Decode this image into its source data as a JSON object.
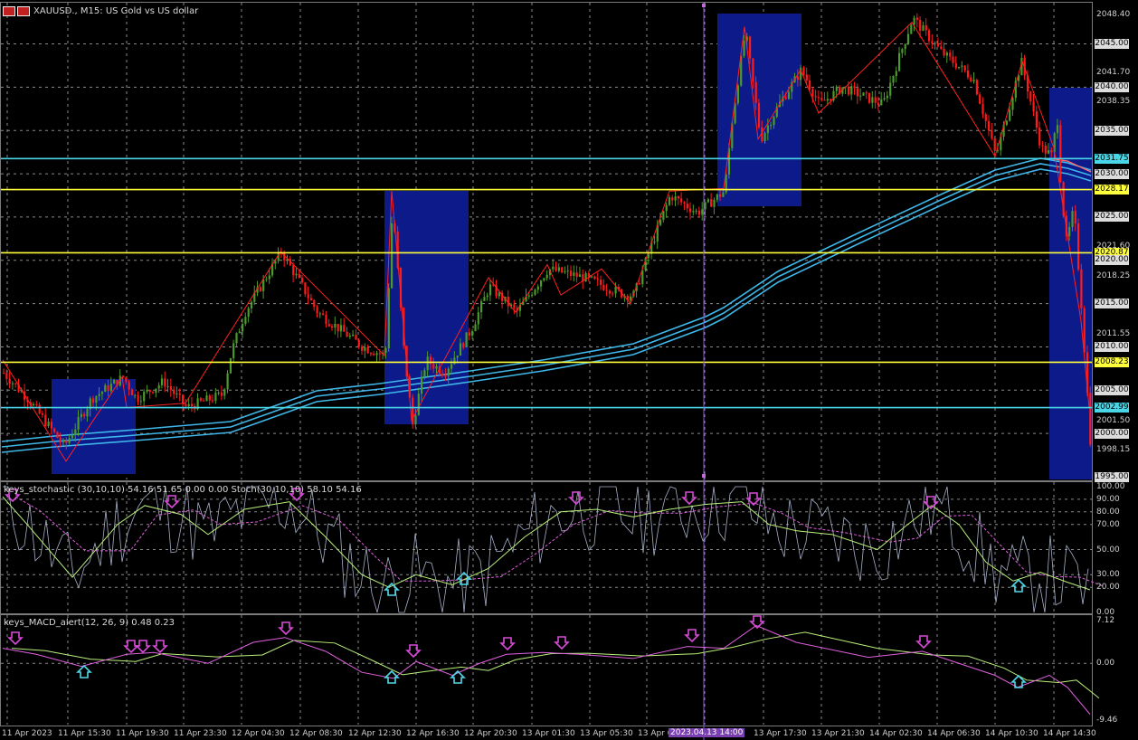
{
  "window": {
    "symbol_title": "XAUUSD., M15: US Gold vs US dollar",
    "icon": "chart-window-icon"
  },
  "price_scale": {
    "labels": [
      "2048.40",
      "2045.00",
      "2041.70",
      "2040.00",
      "2038.35",
      "2035.00",
      "2031.75",
      "2030.00",
      "2028.17",
      "2025.00",
      "2021.60",
      "2020.87",
      "2020.00",
      "2018.25",
      "2015.00",
      "2011.55",
      "2010.00",
      "2008.23",
      "2005.00",
      "2002.99",
      "2001.50",
      "2000.00",
      "1998.15",
      "1995.00"
    ],
    "highlighted": [
      {
        "value": "2045.00",
        "style": "grid"
      },
      {
        "value": "2040.00",
        "style": "grid"
      },
      {
        "value": "2035.00",
        "style": "grid"
      },
      {
        "value": "2031.75",
        "style": "cyan"
      },
      {
        "value": "2030.00",
        "style": "grid"
      },
      {
        "value": "2028.17",
        "style": "yellow"
      },
      {
        "value": "2025.00",
        "style": "grid"
      },
      {
        "value": "2020.87",
        "style": "yellow"
      },
      {
        "value": "2020.00",
        "style": "grid"
      },
      {
        "value": "2015.00",
        "style": "grid"
      },
      {
        "value": "2010.00",
        "style": "grid"
      },
      {
        "value": "2008.23",
        "style": "yellow"
      },
      {
        "value": "2005.00",
        "style": "grid"
      },
      {
        "value": "2002.99",
        "style": "cyan"
      },
      {
        "value": "2000.00",
        "style": "grid"
      },
      {
        "value": "1995.00",
        "style": "grid"
      }
    ],
    "plain": [
      "2048.40",
      "2041.70",
      "2038.35",
      "2021.60",
      "2018.25",
      "2011.55",
      "2001.50",
      "1998.15"
    ]
  },
  "indicator1": {
    "title": "keys_stochastic (30,10,10) 54.16 51.65 0.00 0.00 Stoch(30,10,10) 58.10 54.16",
    "scale": [
      "100.00",
      "90.00",
      "80.00",
      "70.00",
      "50.00",
      "30.00",
      "20.00",
      "0.00"
    ]
  },
  "indicator2": {
    "title": "keys_MACD_alert(12, 26, 9) 0.48 0.23",
    "scale": [
      "7.12",
      "0.00",
      "-9.46"
    ]
  },
  "time_axis": {
    "labels": [
      "11 Apr 2023",
      "11 Apr 15:30",
      "11 Apr 19:30",
      "11 Apr 23:30",
      "12 Apr 04:30",
      "12 Apr 08:30",
      "12 Apr 12:30",
      "12 Apr 16:30",
      "12 Apr 20:30",
      "13 Apr 01:30",
      "13 Apr 05:30",
      "13 Apr 09:30",
      "13 Apr 17:30",
      "13 Apr 21:30",
      "14 Apr 02:30",
      "14 Apr 06:30",
      "14 Apr 10:30",
      "14 Apr 14:30"
    ],
    "crosshair_label": "2023.04.13 14:00"
  },
  "colors": {
    "bull": "#4c9a2a",
    "bear": "#ff1a1a",
    "zigzag": "#ff2020",
    "ma": "#3fb7e8",
    "cyan_level": "#49d6e6",
    "yellow_level": "#ffff3a",
    "box": "#0c1a8a",
    "stoch_main": "#b9f07a",
    "stoch_signal": "#e060e0",
    "stoch_raw": "#a8b0c8",
    "macd_main": "#e060e0",
    "macd_signal": "#b9f07a",
    "arrow_down": "#d84ad8",
    "arrow_up": "#4fd8e8",
    "crosshair": "#8a55d8"
  }
}
